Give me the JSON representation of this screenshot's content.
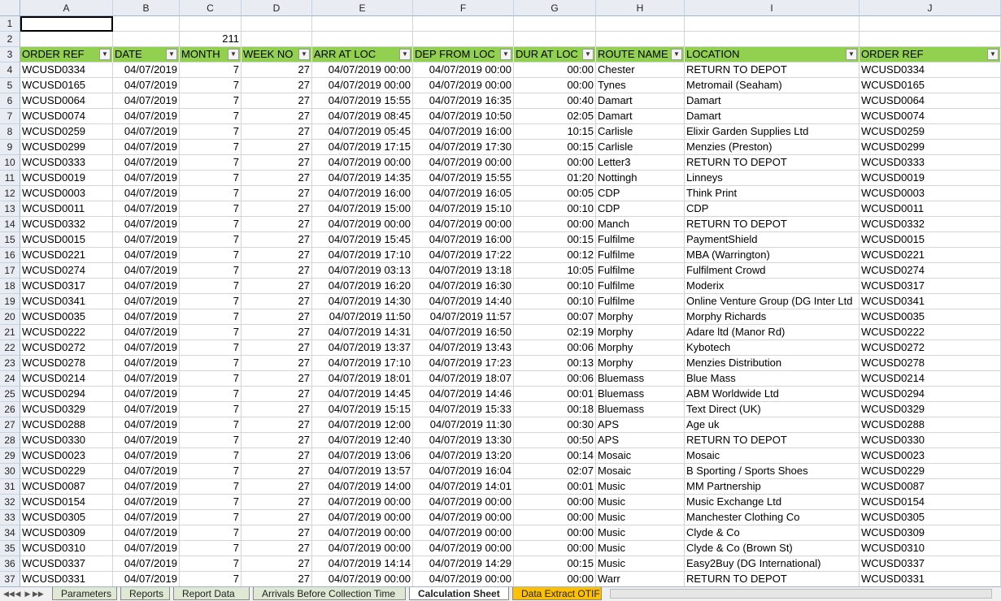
{
  "columns": [
    "A",
    "B",
    "C",
    "D",
    "E",
    "F",
    "G",
    "H",
    "I",
    "J"
  ],
  "row_numbers": [
    "1",
    "2",
    "3",
    "4",
    "5",
    "6",
    "7",
    "8",
    "9",
    "10",
    "11",
    "12",
    "13",
    "14",
    "15",
    "16",
    "17",
    "18",
    "19",
    "20",
    "21",
    "22",
    "23",
    "24",
    "25",
    "26",
    "27",
    "28",
    "29",
    "30",
    "31",
    "32",
    "33",
    "34",
    "35",
    "36",
    "37"
  ],
  "row2_value": "211",
  "headers": [
    "ORDER REF",
    "DATE",
    "MONTH",
    "WEEK NO",
    "ARR AT LOC",
    "DEP FROM LOC",
    "DUR AT LOC",
    "ROUTE NAME",
    "LOCATION",
    "ORDER REF"
  ],
  "filter_glyph": "▼",
  "rows": [
    [
      "WCUSD0334",
      "04/07/2019",
      "7",
      "27",
      "04/07/2019 00:00",
      "04/07/2019 00:00",
      "00:00",
      "Chester",
      "RETURN TO DEPOT",
      "WCUSD0334"
    ],
    [
      "WCUSD0165",
      "04/07/2019",
      "7",
      "27",
      "04/07/2019 00:00",
      "04/07/2019 00:00",
      "00:00",
      "Tynes",
      "Metromail (Seaham)",
      "WCUSD0165"
    ],
    [
      "WCUSD0064",
      "04/07/2019",
      "7",
      "27",
      "04/07/2019 15:55",
      "04/07/2019 16:35",
      "00:40",
      "Damart",
      "Damart",
      "WCUSD0064"
    ],
    [
      "WCUSD0074",
      "04/07/2019",
      "7",
      "27",
      "04/07/2019 08:45",
      "04/07/2019 10:50",
      "02:05",
      "Damart",
      "Damart",
      "WCUSD0074"
    ],
    [
      "WCUSD0259",
      "04/07/2019",
      "7",
      "27",
      "04/07/2019 05:45",
      "04/07/2019 16:00",
      "10:15",
      "Carlisle",
      "Elixir Garden Supplies Ltd",
      "WCUSD0259"
    ],
    [
      "WCUSD0299",
      "04/07/2019",
      "7",
      "27",
      "04/07/2019 17:15",
      "04/07/2019 17:30",
      "00:15",
      "Carlisle",
      "Menzies (Preston)",
      "WCUSD0299"
    ],
    [
      "WCUSD0333",
      "04/07/2019",
      "7",
      "27",
      "04/07/2019 00:00",
      "04/07/2019 00:00",
      "00:00",
      "Letter3",
      "RETURN TO DEPOT",
      "WCUSD0333"
    ],
    [
      "WCUSD0019",
      "04/07/2019",
      "7",
      "27",
      "04/07/2019 14:35",
      "04/07/2019 15:55",
      "01:20",
      "Nottingh",
      "Linneys",
      "WCUSD0019"
    ],
    [
      "WCUSD0003",
      "04/07/2019",
      "7",
      "27",
      "04/07/2019 16:00",
      "04/07/2019 16:05",
      "00:05",
      "CDP",
      "Think Print",
      "WCUSD0003"
    ],
    [
      "WCUSD0011",
      "04/07/2019",
      "7",
      "27",
      "04/07/2019 15:00",
      "04/07/2019 15:10",
      "00:10",
      "CDP",
      "CDP",
      "WCUSD0011"
    ],
    [
      "WCUSD0332",
      "04/07/2019",
      "7",
      "27",
      "04/07/2019 00:00",
      "04/07/2019 00:00",
      "00:00",
      "Manch",
      "RETURN TO DEPOT",
      "WCUSD0332"
    ],
    [
      "WCUSD0015",
      "04/07/2019",
      "7",
      "27",
      "04/07/2019 15:45",
      "04/07/2019 16:00",
      "00:15",
      "Fulfilme",
      "PaymentShield",
      "WCUSD0015"
    ],
    [
      "WCUSD0221",
      "04/07/2019",
      "7",
      "27",
      "04/07/2019 17:10",
      "04/07/2019 17:22",
      "00:12",
      "Fulfilme",
      "MBA (Warrington)",
      "WCUSD0221"
    ],
    [
      "WCUSD0274",
      "04/07/2019",
      "7",
      "27",
      "04/07/2019 03:13",
      "04/07/2019 13:18",
      "10:05",
      "Fulfilme",
      "Fulfilment Crowd",
      "WCUSD0274"
    ],
    [
      "WCUSD0317",
      "04/07/2019",
      "7",
      "27",
      "04/07/2019 16:20",
      "04/07/2019 16:30",
      "00:10",
      "Fulfilme",
      "Moderix",
      "WCUSD0317"
    ],
    [
      "WCUSD0341",
      "04/07/2019",
      "7",
      "27",
      "04/07/2019 14:30",
      "04/07/2019 14:40",
      "00:10",
      "Fulfilme",
      "Online Venture Group (DG Inter Ltd",
      "WCUSD0341"
    ],
    [
      "WCUSD0035",
      "04/07/2019",
      "7",
      "27",
      "04/07/2019 11:50",
      "04/07/2019 11:57",
      "00:07",
      "Morphy",
      "Morphy Richards",
      "WCUSD0035"
    ],
    [
      "WCUSD0222",
      "04/07/2019",
      "7",
      "27",
      "04/07/2019 14:31",
      "04/07/2019 16:50",
      "02:19",
      "Morphy",
      "Adare ltd (Manor Rd)",
      "WCUSD0222"
    ],
    [
      "WCUSD0272",
      "04/07/2019",
      "7",
      "27",
      "04/07/2019 13:37",
      "04/07/2019 13:43",
      "00:06",
      "Morphy",
      "Kybotech",
      "WCUSD0272"
    ],
    [
      "WCUSD0278",
      "04/07/2019",
      "7",
      "27",
      "04/07/2019 17:10",
      "04/07/2019 17:23",
      "00:13",
      "Morphy",
      "Menzies Distribution",
      "WCUSD0278"
    ],
    [
      "WCUSD0214",
      "04/07/2019",
      "7",
      "27",
      "04/07/2019 18:01",
      "04/07/2019 18:07",
      "00:06",
      "Bluemass",
      "Blue Mass",
      "WCUSD0214"
    ],
    [
      "WCUSD0294",
      "04/07/2019",
      "7",
      "27",
      "04/07/2019 14:45",
      "04/07/2019 14:46",
      "00:01",
      "Bluemass",
      "ABM Worldwide Ltd",
      "WCUSD0294"
    ],
    [
      "WCUSD0329",
      "04/07/2019",
      "7",
      "27",
      "04/07/2019 15:15",
      "04/07/2019 15:33",
      "00:18",
      "Bluemass",
      "Text Direct (UK)",
      "WCUSD0329"
    ],
    [
      "WCUSD0288",
      "04/07/2019",
      "7",
      "27",
      "04/07/2019 12:00",
      "04/07/2019 11:30",
      "00:30",
      "APS",
      "Age uk",
      "WCUSD0288"
    ],
    [
      "WCUSD0330",
      "04/07/2019",
      "7",
      "27",
      "04/07/2019 12:40",
      "04/07/2019 13:30",
      "00:50",
      "APS",
      "RETURN TO DEPOT",
      "WCUSD0330"
    ],
    [
      "WCUSD0023",
      "04/07/2019",
      "7",
      "27",
      "04/07/2019 13:06",
      "04/07/2019 13:20",
      "00:14",
      "Mosaic",
      "Mosaic",
      "WCUSD0023"
    ],
    [
      "WCUSD0229",
      "04/07/2019",
      "7",
      "27",
      "04/07/2019 13:57",
      "04/07/2019 16:04",
      "02:07",
      "Mosaic",
      "B Sporting / Sports Shoes",
      "WCUSD0229"
    ],
    [
      "WCUSD0087",
      "04/07/2019",
      "7",
      "27",
      "04/07/2019 14:00",
      "04/07/2019 14:01",
      "00:01",
      "Music",
      "MM Partnership",
      "WCUSD0087"
    ],
    [
      "WCUSD0154",
      "04/07/2019",
      "7",
      "27",
      "04/07/2019 00:00",
      "04/07/2019 00:00",
      "00:00",
      "Music",
      "Music Exchange Ltd",
      "WCUSD0154"
    ],
    [
      "WCUSD0305",
      "04/07/2019",
      "7",
      "27",
      "04/07/2019 00:00",
      "04/07/2019 00:00",
      "00:00",
      "Music",
      "Manchester Clothing Co",
      "WCUSD0305"
    ],
    [
      "WCUSD0309",
      "04/07/2019",
      "7",
      "27",
      "04/07/2019 00:00",
      "04/07/2019 00:00",
      "00:00",
      "Music",
      "Clyde & Co",
      "WCUSD0309"
    ],
    [
      "WCUSD0310",
      "04/07/2019",
      "7",
      "27",
      "04/07/2019 00:00",
      "04/07/2019 00:00",
      "00:00",
      "Music",
      "Clyde & Co (Brown St)",
      "WCUSD0310"
    ],
    [
      "WCUSD0337",
      "04/07/2019",
      "7",
      "27",
      "04/07/2019 14:14",
      "04/07/2019 14:29",
      "00:15",
      "Music",
      "Easy2Buy (DG International)",
      "WCUSD0337"
    ],
    [
      "WCUSD0331",
      "04/07/2019",
      "7",
      "27",
      "04/07/2019 00:00",
      "04/07/2019 00:00",
      "00:00",
      "Warr",
      "RETURN TO DEPOT",
      "WCUSD0331"
    ]
  ],
  "sheet_tabs": [
    {
      "label": "Parameters",
      "state": "normal"
    },
    {
      "label": "Reports",
      "state": "normal"
    },
    {
      "label": "Report Data",
      "state": "normal"
    },
    {
      "label": "Arrivals Before Collection Time",
      "state": "normal"
    },
    {
      "label": "Calculation Sheet",
      "state": "active"
    },
    {
      "label": "Data Extract OTIF",
      "state": "orange"
    }
  ],
  "nav_buttons": [
    "◀◀",
    "◀",
    "▶",
    "▶▶"
  ],
  "colors": {
    "header_fill": "#92d050",
    "tab_orange": "#ffc000",
    "grid_line": "#d4d4d4",
    "heading_bg": "#e9edf3"
  }
}
